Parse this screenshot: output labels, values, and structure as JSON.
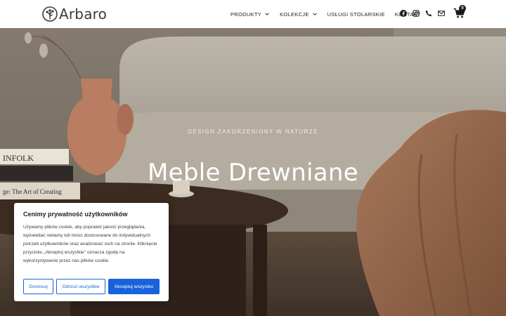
{
  "brand": {
    "name": "Arbaro"
  },
  "nav": {
    "items": [
      {
        "label": "PRODUKTY",
        "has_dropdown": true
      },
      {
        "label": "KOLEKCJE",
        "has_dropdown": true
      },
      {
        "label": "USŁUGI STOLARSKIE",
        "has_dropdown": false
      },
      {
        "label": "KONTAKT",
        "has_dropdown": false
      }
    ],
    "social_icons": [
      "facebook-icon",
      "instagram-icon",
      "phone-icon",
      "mail-icon"
    ],
    "cart": {
      "count": "0"
    }
  },
  "hero": {
    "subtitle": "DESIGN ZAKORZENIONY W NATURZE",
    "title": "Meble Drewniane",
    "book_spines": [
      "INFOLK",
      "ge: The Art of Creating"
    ]
  },
  "cookie": {
    "title": "Cenimy prywatność użytkowników",
    "text": "Używamy plików cookie, aby poprawić jakość przeglądania, wyświetlać reklamy lub treści dostosowane do indywidualnych potrzeb użytkowników oraz analizować ruch na stronie. Kliknięcie przycisku „Akceptuj wszystkie” oznacza zgodę na wykorzystywanie przez nas plików cookie.",
    "buttons": {
      "customize": "Dostosuj",
      "reject": "Odrzuć wszystkie",
      "accept": "Akceptuj wszystko"
    }
  },
  "colors": {
    "accent": "#1863dc",
    "header_bg": "#ffffff",
    "text_dark": "#1d1d1d"
  }
}
